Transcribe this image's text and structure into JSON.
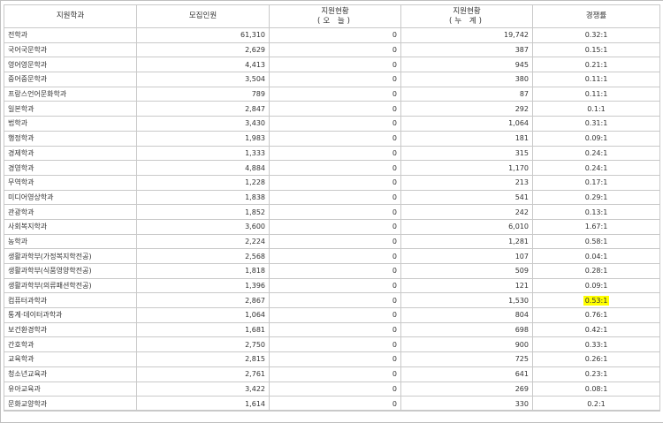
{
  "table": {
    "headers": {
      "dept": "지원학과",
      "quota": "모집인원",
      "today_1": "지원현황",
      "today_2": "(오 늘)",
      "total_1": "지원현황",
      "total_2": "(누 계)",
      "rate": "경쟁률"
    },
    "rows": [
      {
        "dept": "전학과",
        "quota": "61,310",
        "today": "0",
        "total": "19,742",
        "rate": "0.32:1"
      },
      {
        "dept": "국어국문학과",
        "quota": "2,629",
        "today": "0",
        "total": "387",
        "rate": "0.15:1"
      },
      {
        "dept": "영어영문학과",
        "quota": "4,413",
        "today": "0",
        "total": "945",
        "rate": "0.21:1"
      },
      {
        "dept": "중어중문학과",
        "quota": "3,504",
        "today": "0",
        "total": "380",
        "rate": "0.11:1"
      },
      {
        "dept": "프랑스언어문화학과",
        "quota": "789",
        "today": "0",
        "total": "87",
        "rate": "0.11:1"
      },
      {
        "dept": "일본학과",
        "quota": "2,847",
        "today": "0",
        "total": "292",
        "rate": "0.1:1"
      },
      {
        "dept": "법학과",
        "quota": "3,430",
        "today": "0",
        "total": "1,064",
        "rate": "0.31:1"
      },
      {
        "dept": "행정학과",
        "quota": "1,983",
        "today": "0",
        "total": "181",
        "rate": "0.09:1"
      },
      {
        "dept": "경제학과",
        "quota": "1,333",
        "today": "0",
        "total": "315",
        "rate": "0.24:1"
      },
      {
        "dept": "경영학과",
        "quota": "4,884",
        "today": "0",
        "total": "1,170",
        "rate": "0.24:1"
      },
      {
        "dept": "무역학과",
        "quota": "1,228",
        "today": "0",
        "total": "213",
        "rate": "0.17:1"
      },
      {
        "dept": "미디어영상학과",
        "quota": "1,838",
        "today": "0",
        "total": "541",
        "rate": "0.29:1"
      },
      {
        "dept": "관광학과",
        "quota": "1,852",
        "today": "0",
        "total": "242",
        "rate": "0.13:1"
      },
      {
        "dept": "사회복지학과",
        "quota": "3,600",
        "today": "0",
        "total": "6,010",
        "rate": "1.67:1"
      },
      {
        "dept": "농학과",
        "quota": "2,224",
        "today": "0",
        "total": "1,281",
        "rate": "0.58:1"
      },
      {
        "dept": "생활과학부(가정복지학전공)",
        "quota": "2,568",
        "today": "0",
        "total": "107",
        "rate": "0.04:1"
      },
      {
        "dept": "생활과학부(식품영양학전공)",
        "quota": "1,818",
        "today": "0",
        "total": "509",
        "rate": "0.28:1"
      },
      {
        "dept": "생활과학부(의류패션학전공)",
        "quota": "1,396",
        "today": "0",
        "total": "121",
        "rate": "0.09:1"
      },
      {
        "dept": "컴퓨터과학과",
        "quota": "2,867",
        "today": "0",
        "total": "1,530",
        "rate": "0.53:1",
        "highlight": true
      },
      {
        "dept": "통계·데이터과학과",
        "quota": "1,064",
        "today": "0",
        "total": "804",
        "rate": "0.76:1"
      },
      {
        "dept": "보건환경학과",
        "quota": "1,681",
        "today": "0",
        "total": "698",
        "rate": "0.42:1"
      },
      {
        "dept": "간호학과",
        "quota": "2,750",
        "today": "0",
        "total": "900",
        "rate": "0.33:1"
      },
      {
        "dept": "교육학과",
        "quota": "2,815",
        "today": "0",
        "total": "725",
        "rate": "0.26:1"
      },
      {
        "dept": "청소년교육과",
        "quota": "2,761",
        "today": "0",
        "total": "641",
        "rate": "0.23:1"
      },
      {
        "dept": "유아교육과",
        "quota": "3,422",
        "today": "0",
        "total": "269",
        "rate": "0.08:1"
      },
      {
        "dept": "문화교양학과",
        "quota": "1,614",
        "today": "0",
        "total": "330",
        "rate": "0.2:1"
      }
    ]
  },
  "colors": {
    "highlight": "#ffff00",
    "border": "#c9c9c9"
  }
}
